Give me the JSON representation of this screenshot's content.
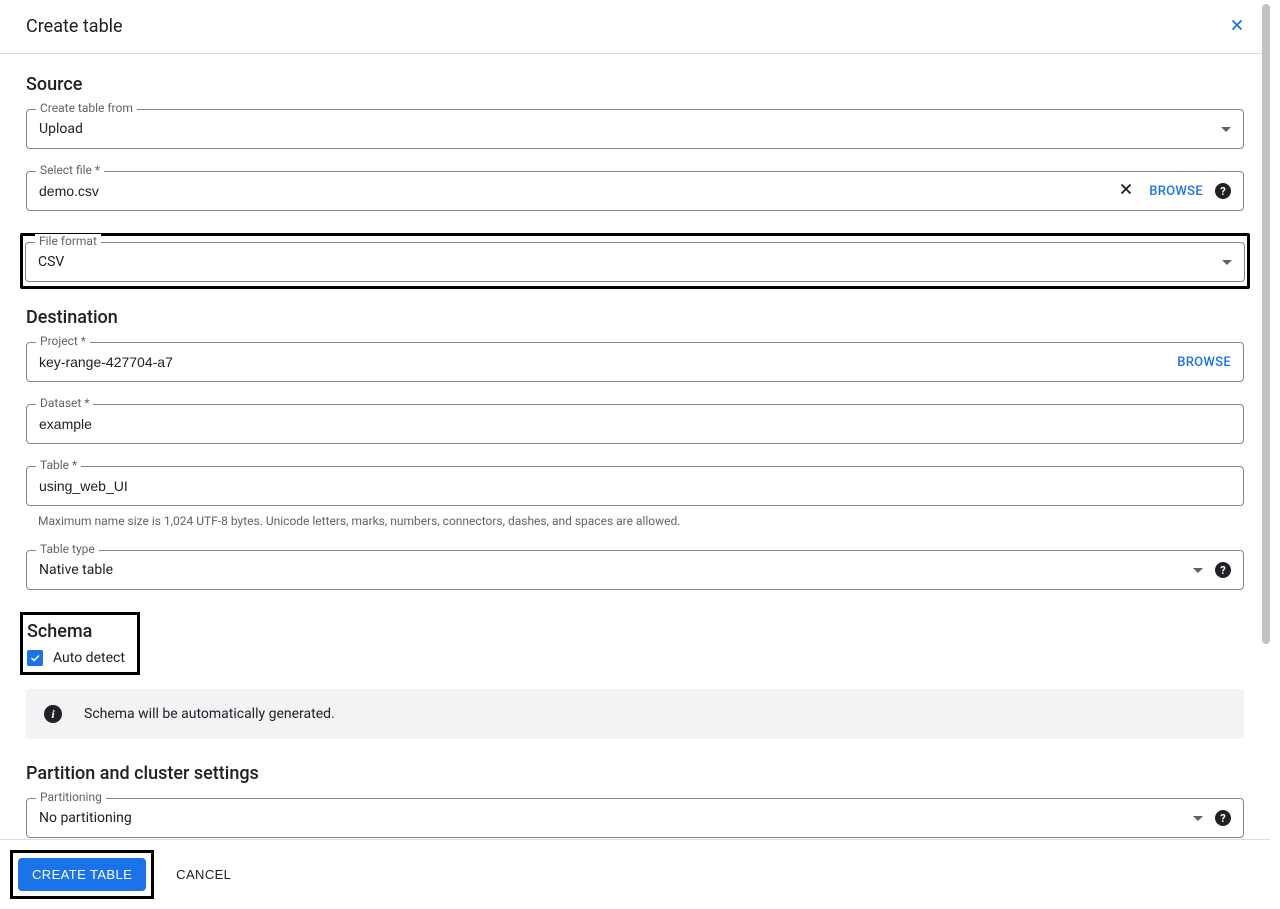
{
  "header": {
    "title": "Create table"
  },
  "source": {
    "title": "Source",
    "create_from": {
      "label": "Create table from",
      "value": "Upload"
    },
    "select_file": {
      "label": "Select file *",
      "value": "demo.csv",
      "browse": "BROWSE"
    },
    "file_format": {
      "label": "File format",
      "value": "CSV"
    }
  },
  "destination": {
    "title": "Destination",
    "project": {
      "label": "Project *",
      "value": "key-range-427704-a7",
      "browse": "BROWSE"
    },
    "dataset": {
      "label": "Dataset *",
      "value": "example"
    },
    "table": {
      "label": "Table *",
      "value": "using_web_UI"
    },
    "table_hint": "Maximum name size is 1,024 UTF-8 bytes. Unicode letters, marks, numbers, connectors, dashes, and spaces are allowed.",
    "table_type": {
      "label": "Table type",
      "value": "Native table"
    }
  },
  "schema": {
    "title": "Schema",
    "auto_detect_label": "Auto detect",
    "auto_detect_checked": true,
    "info_text": "Schema will be automatically generated."
  },
  "partition": {
    "title": "Partition and cluster settings",
    "partitioning": {
      "label": "Partitioning",
      "value": "No partitioning"
    }
  },
  "footer": {
    "create": "CREATE TABLE",
    "cancel": "CANCEL"
  }
}
